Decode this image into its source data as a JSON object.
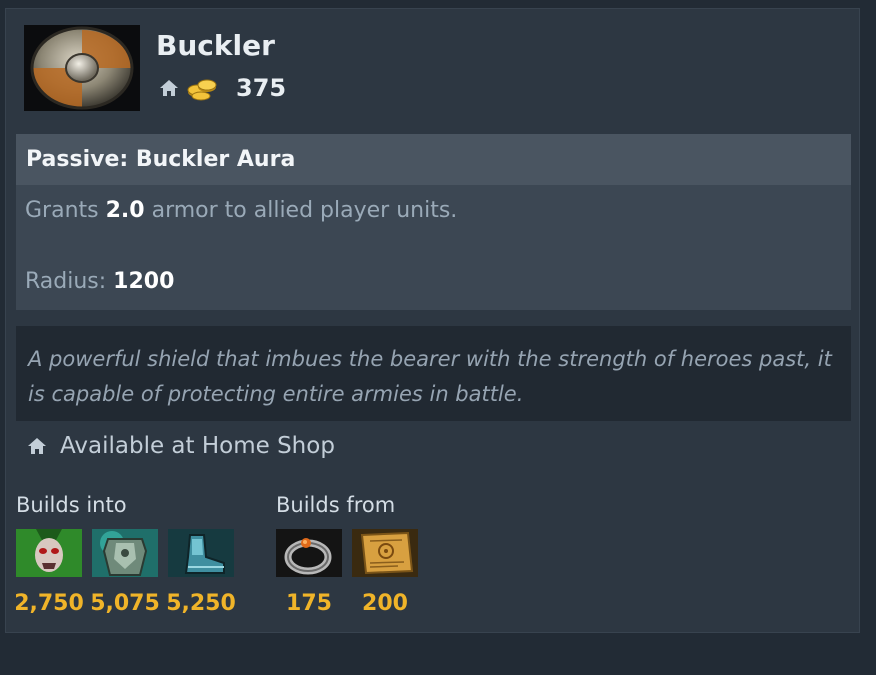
{
  "item": {
    "name": "Buckler",
    "icon": "buckler-shield-icon",
    "cost": "375",
    "shop_icon": "home-icon",
    "currency_icon": "gold-coins-icon"
  },
  "ability": {
    "title": "Passive: Buckler Aura",
    "desc_prefix": "Grants ",
    "armor_value": "2.0",
    "desc_suffix": " armor to allied player units.",
    "radius_label": "Radius: ",
    "radius_value": "1200"
  },
  "lore": "A powerful shield that imbues the bearer with the strength of heroes past, it is capable of protecting entire armies in battle.",
  "availability": {
    "icon": "home-icon",
    "text": "Available at Home Shop"
  },
  "builds_into": {
    "label": "Builds into",
    "items": [
      {
        "icon": "skull-mask-item-icon",
        "price": "2,750"
      },
      {
        "icon": "armor-cuirass-item-icon",
        "price": "5,075"
      },
      {
        "icon": "boots-item-icon",
        "price": "5,250"
      }
    ]
  },
  "builds_from": {
    "label": "Builds from",
    "items": [
      {
        "icon": "ring-item-icon",
        "price": "175"
      },
      {
        "icon": "recipe-scroll-item-icon",
        "price": "200"
      }
    ]
  },
  "colors": {
    "background": "#222b35",
    "panel": "#2d3742",
    "price_gold": "#f0b429"
  }
}
